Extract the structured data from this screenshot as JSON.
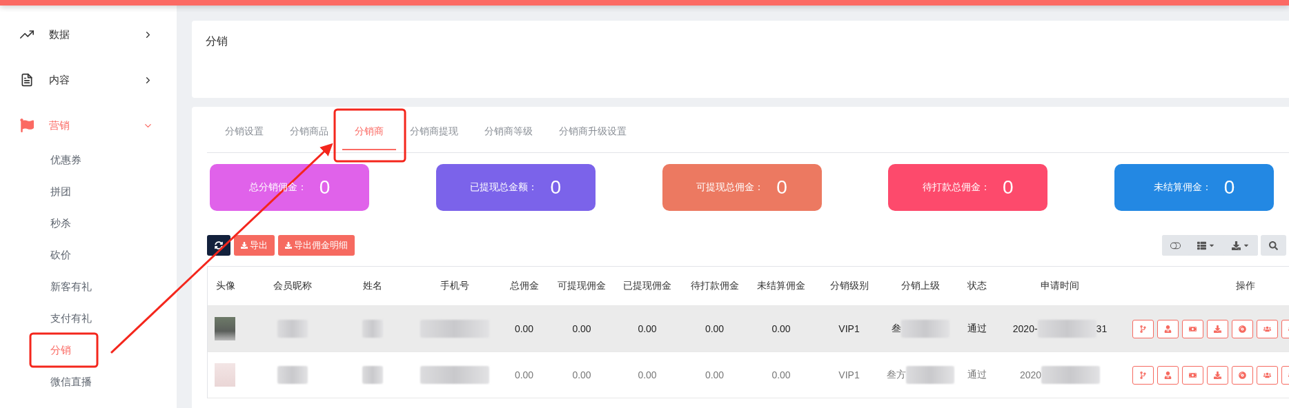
{
  "sidebar": {
    "items": [
      {
        "label": "数据",
        "expanded": false,
        "selected": false
      },
      {
        "label": "内容",
        "expanded": false,
        "selected": false
      },
      {
        "label": "营销",
        "expanded": true,
        "selected": true,
        "children": [
          {
            "label": "优惠券",
            "selected": false
          },
          {
            "label": "拼团",
            "selected": false
          },
          {
            "label": "秒杀",
            "selected": false
          },
          {
            "label": "砍价",
            "selected": false
          },
          {
            "label": "新客有礼",
            "selected": false
          },
          {
            "label": "支付有礼",
            "selected": false
          },
          {
            "label": "分销",
            "selected": true
          },
          {
            "label": "微信直播",
            "selected": false
          }
        ]
      }
    ]
  },
  "page_header": {
    "title": "分销"
  },
  "tabs": [
    {
      "label": "分销设置",
      "selected": false
    },
    {
      "label": "分销商品",
      "selected": false
    },
    {
      "label": "分销商",
      "selected": true
    },
    {
      "label": "分销商提现",
      "selected": false
    },
    {
      "label": "分销商等级",
      "selected": false
    },
    {
      "label": "分销商升级设置",
      "selected": false
    }
  ],
  "stats": [
    {
      "label": "总分销佣金：",
      "value": "0",
      "color": "#e062ea"
    },
    {
      "label": "已提现总金额：",
      "value": "0",
      "color": "#7b63ea"
    },
    {
      "label": "可提现总佣金：",
      "value": "0",
      "color": "#ec7961"
    },
    {
      "label": "待打款总佣金：",
      "value": "0",
      "color": "#fd4a6c"
    },
    {
      "label": "未结算佣金：",
      "value": "0",
      "color": "#2388e3"
    }
  ],
  "toolbar": {
    "buttons": [
      {
        "kind": "refresh"
      },
      {
        "kind": "export",
        "label": "导出"
      },
      {
        "kind": "export",
        "label": "导出佣金明细"
      }
    ]
  },
  "table": {
    "columns": [
      "头像",
      "会员昵称",
      "姓名",
      "手机号",
      "总佣金",
      "可提现佣金",
      "已提现佣金",
      "待打款佣金",
      "未结算佣金",
      "分销级别",
      "分销上级",
      "状态",
      "申请时间",
      "操作"
    ],
    "rows": [
      {
        "highlighted": true,
        "total": "0.00",
        "withdrawable": "0.00",
        "withdrawn": "0.00",
        "pending": "0.00",
        "unsettled": "0.00",
        "level": "VIP1",
        "parent": "叁",
        "status": "通过",
        "applied_start": "2020-",
        "applied_end": "31"
      },
      {
        "highlighted": false,
        "total": "0.00",
        "withdrawable": "0.00",
        "withdrawn": "0.00",
        "pending": "0.00",
        "unsettled": "0.00",
        "level": "VIP1",
        "parent": "叁方",
        "status": "通过",
        "applied_start": "2020"
      }
    ]
  }
}
